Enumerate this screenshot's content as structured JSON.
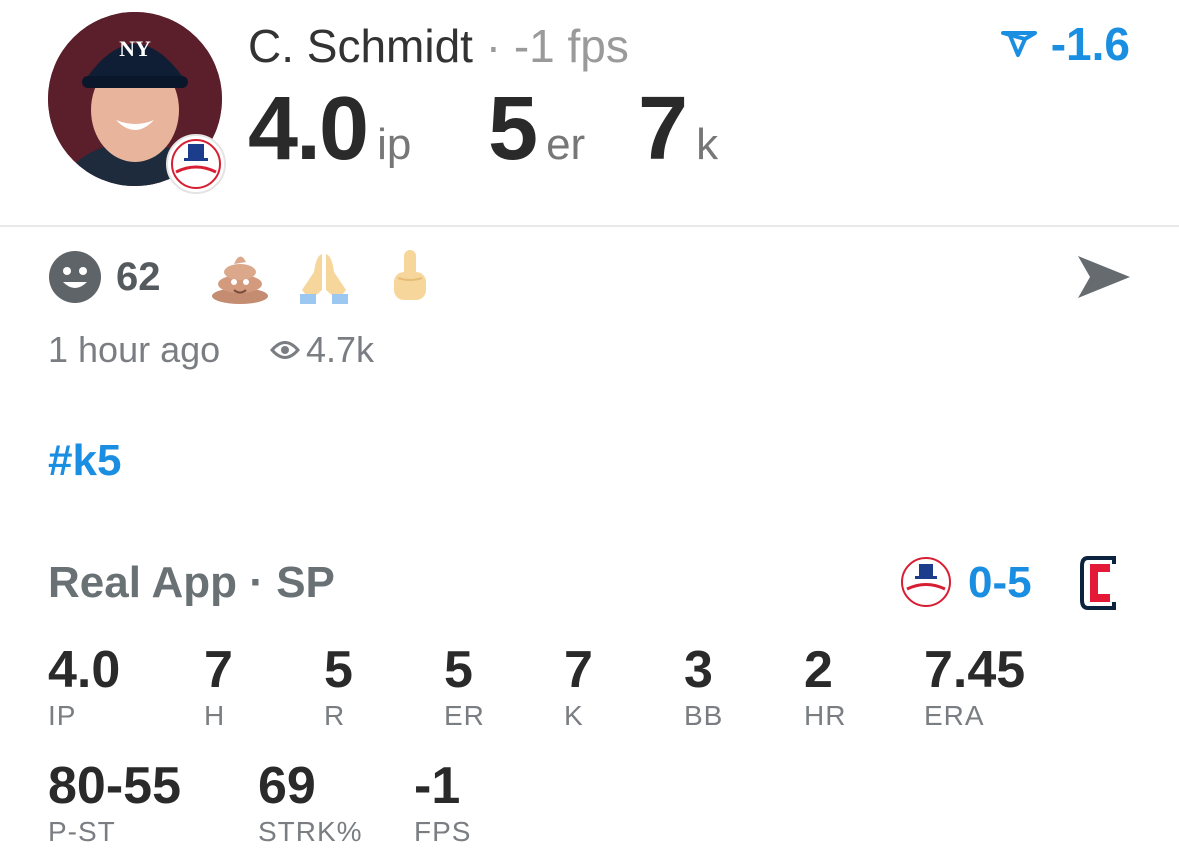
{
  "player": {
    "name": "C. Schmidt",
    "separator": "·",
    "fps_text": "-1 fps",
    "score": "-1.6",
    "team_color": "#0c2340"
  },
  "headline_stats": [
    {
      "value": "4.0",
      "label": "ip"
    },
    {
      "value": "5",
      "label": "er"
    },
    {
      "value": "7",
      "label": "k"
    }
  ],
  "reactions": {
    "count": "62",
    "emojis": [
      "poop",
      "praying-hands",
      "middle-finger"
    ]
  },
  "meta": {
    "time": "1 hour ago",
    "views": "4.7k"
  },
  "hashtag": "#k5",
  "game": {
    "app": "Real App",
    "separator": "·",
    "position": "SP",
    "score": "0-5",
    "away_team": "Yankees",
    "home_team": "Guardians",
    "accent": "#1a8ee0"
  },
  "stats_row1": [
    {
      "value": "4.0",
      "label": "IP"
    },
    {
      "value": "7",
      "label": "H"
    },
    {
      "value": "5",
      "label": "R"
    },
    {
      "value": "5",
      "label": "ER"
    },
    {
      "value": "7",
      "label": "K"
    },
    {
      "value": "3",
      "label": "BB"
    },
    {
      "value": "2",
      "label": "HR"
    },
    {
      "value": "7.45",
      "label": "ERA"
    }
  ],
  "stats_row2": [
    {
      "value": "80-55",
      "label": "P-ST"
    },
    {
      "value": "69",
      "label": "STRK%"
    },
    {
      "value": "-1",
      "label": "FPS"
    }
  ]
}
